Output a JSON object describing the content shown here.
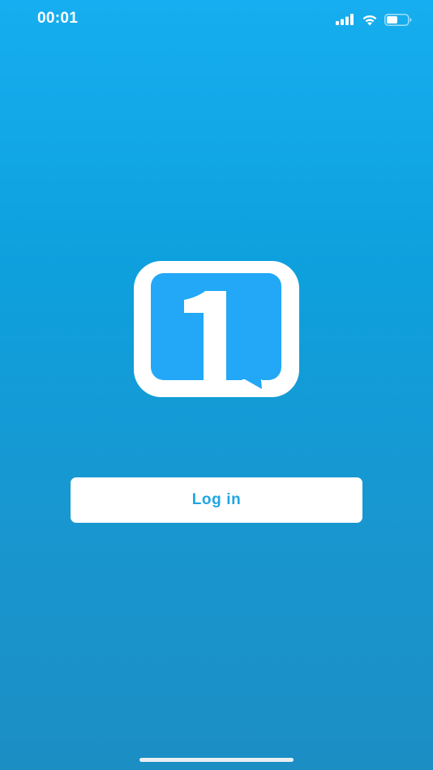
{
  "status_bar": {
    "time": "00:01",
    "icons": [
      "cellular-signal-icon",
      "wifi-icon",
      "battery-icon"
    ]
  },
  "logo": {
    "icon": "speech-bubble-number-one-logo",
    "digit": "1"
  },
  "login": {
    "label": "Log in"
  },
  "colors": {
    "background_top": "#16aef0",
    "background_bottom": "#1b8ec4",
    "logo_fill": "#22a8f6",
    "button_bg": "#ffffff",
    "button_text": "#1ea6e3"
  }
}
